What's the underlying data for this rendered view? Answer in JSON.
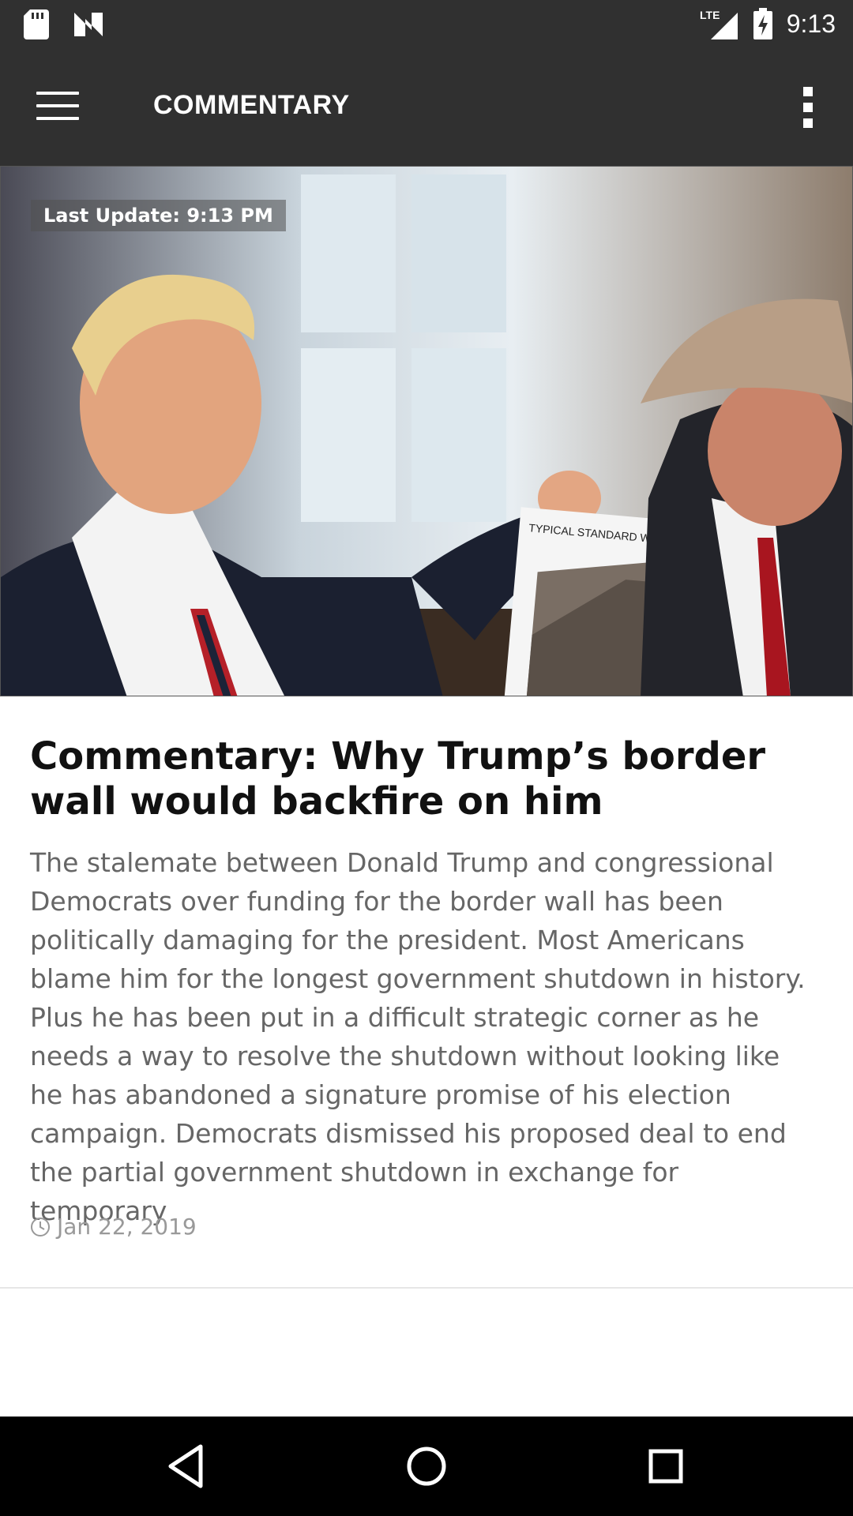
{
  "status_bar": {
    "time": "9:13",
    "network": "LTE",
    "icons": [
      "sd-card-icon",
      "n-notification-icon",
      "signal-icon",
      "battery-charging-icon"
    ]
  },
  "app_bar": {
    "title": "COMMENTARY",
    "menu_icon": "hamburger-menu-icon",
    "overflow_icon": "more-vert-icon"
  },
  "hero": {
    "last_update": "Last Update: 9:13 PM",
    "document_heading": "TYPICAL STANDARD WALL DESIGN"
  },
  "article": {
    "headline": "Commentary: Why Trump’s border wall would backfire on him",
    "summary": "The stalemate between Donald Trump and congressional Democrats over funding for the border wall has been politically damaging for the president. Most Americans blame him for the longest government shutdown in history. Plus he has been put in a difficult strategic corner as he needs a way to resolve the shutdown without looking like he has abandoned a signature promise of his election campaign. Democrats dismissed his proposed deal to end the partial government shutdown in exchange for temporary",
    "date": "Jan 22, 2019",
    "date_icon": "clock-icon"
  },
  "nav_bar": {
    "buttons": [
      "back-icon",
      "home-icon",
      "recents-icon"
    ]
  },
  "colors": {
    "toolbar": "#303030",
    "nav_bar": "#000000",
    "headline": "#111111",
    "summary": "#666666",
    "meta": "#999999"
  }
}
